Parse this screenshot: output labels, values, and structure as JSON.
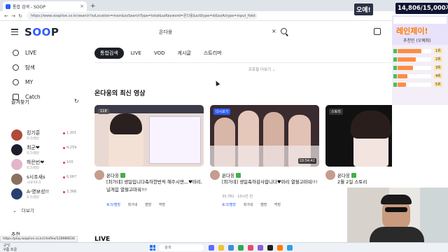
{
  "browser": {
    "tab_title": "통합 검색 - SOOP",
    "new_tab_symbol": "+",
    "url": "https://www.sooplive.co.kr/search?szLocation=main&szSearchType=total&szKeyword=온다웅&szStype=di&szActype=input_field"
  },
  "header": {
    "logo_part1": "S",
    "logo_part2": "OO",
    "logo_part3": "P",
    "search_value": "온다웅",
    "clear_symbol": "×"
  },
  "sidebar": {
    "nav": [
      {
        "label": "LIVE",
        "icon": "live-icon"
      },
      {
        "label": "탐색",
        "icon": "compass-icon"
      },
      {
        "label": "MY",
        "icon": "user-icon"
      },
      {
        "label": "Catch",
        "icon": "catch-icon"
      }
    ],
    "favorites_title": "즐겨찾기",
    "favorites": [
      {
        "name": "킹기훈",
        "sub": "토크/캠방",
        "count": "1,301",
        "color": "#b04a3a"
      },
      {
        "name": "최군❤",
        "sub": "토크/캠방",
        "count": "4,259",
        "color": "#1c1f2a"
      },
      {
        "name": "하은빈❤",
        "sub": "토크/캠방",
        "count": "100",
        "color": "#e2b6c8"
      },
      {
        "name": "s시조새s",
        "sub": "시네마토크",
        "count": "6,067",
        "color": "#8a7060"
      },
      {
        "name": "A-영보성!!",
        "sub": "토크/캠방",
        "count": "3,366",
        "color": "#27406e"
      }
    ],
    "more_label": "더보기",
    "recommend_title": "추천"
  },
  "main": {
    "tabs": [
      "통합검색",
      "LIVE",
      "VOD",
      "게시글",
      "스트리머"
    ],
    "search_more": "프로필 더보기",
    "section_title": "온다웅의 최신 영상",
    "live_title": "LIVE",
    "cards": [
      {
        "badge": "118",
        "badge_color": "#555555",
        "duration": "",
        "author": "온다웅",
        "title": "[최가네] 생일입니다축하한번씩 해주시면,,,♥마리,널게음 열혈고마워!!!",
        "meta": "",
        "tags": [
          "토크/캠방",
          "최가네",
          "캠방",
          "먹방"
        ]
      },
      {
        "badge": "다시보기",
        "badge_color": "#2d5cff",
        "duration": "10:54:42",
        "author": "온다웅",
        "title": "[최가네] 생일축하감사합니다♥마리 열혈고마워!!!",
        "meta": "33,781 · 10시간 전",
        "tags": [
          "토크/캠방",
          "최가네",
          "캠방",
          "먹방"
        ]
      },
      {
        "badge": "스토리",
        "badge_color": "#333333",
        "duration": "",
        "author": "온다웅",
        "title": "2월 2일 스토리",
        "meta": "",
        "tags": []
      }
    ]
  },
  "overlay": {
    "banner_left": "오예!",
    "banner_right": "14,806/15,000개",
    "panel_title": "레인제이!",
    "panel_sub": "추천인 (오예최)",
    "panel_top": "오예!",
    "panel_top_sub": "",
    "rows": [
      {
        "fill": 0.7,
        "tag": "1위"
      },
      {
        "fill": 0.55,
        "tag": "2위"
      },
      {
        "fill": 0.45,
        "tag": "3위"
      },
      {
        "fill": 0.3,
        "tag": "4위"
      },
      {
        "fill": 0.25,
        "tag": "5위"
      }
    ]
  },
  "taskbar": {
    "weather_temp": "-2°C",
    "weather_desc": "구름 조금",
    "search_placeholder": "검색"
  },
  "status_url": "https://play.sooplive.co.kr/cheflee/128986634"
}
